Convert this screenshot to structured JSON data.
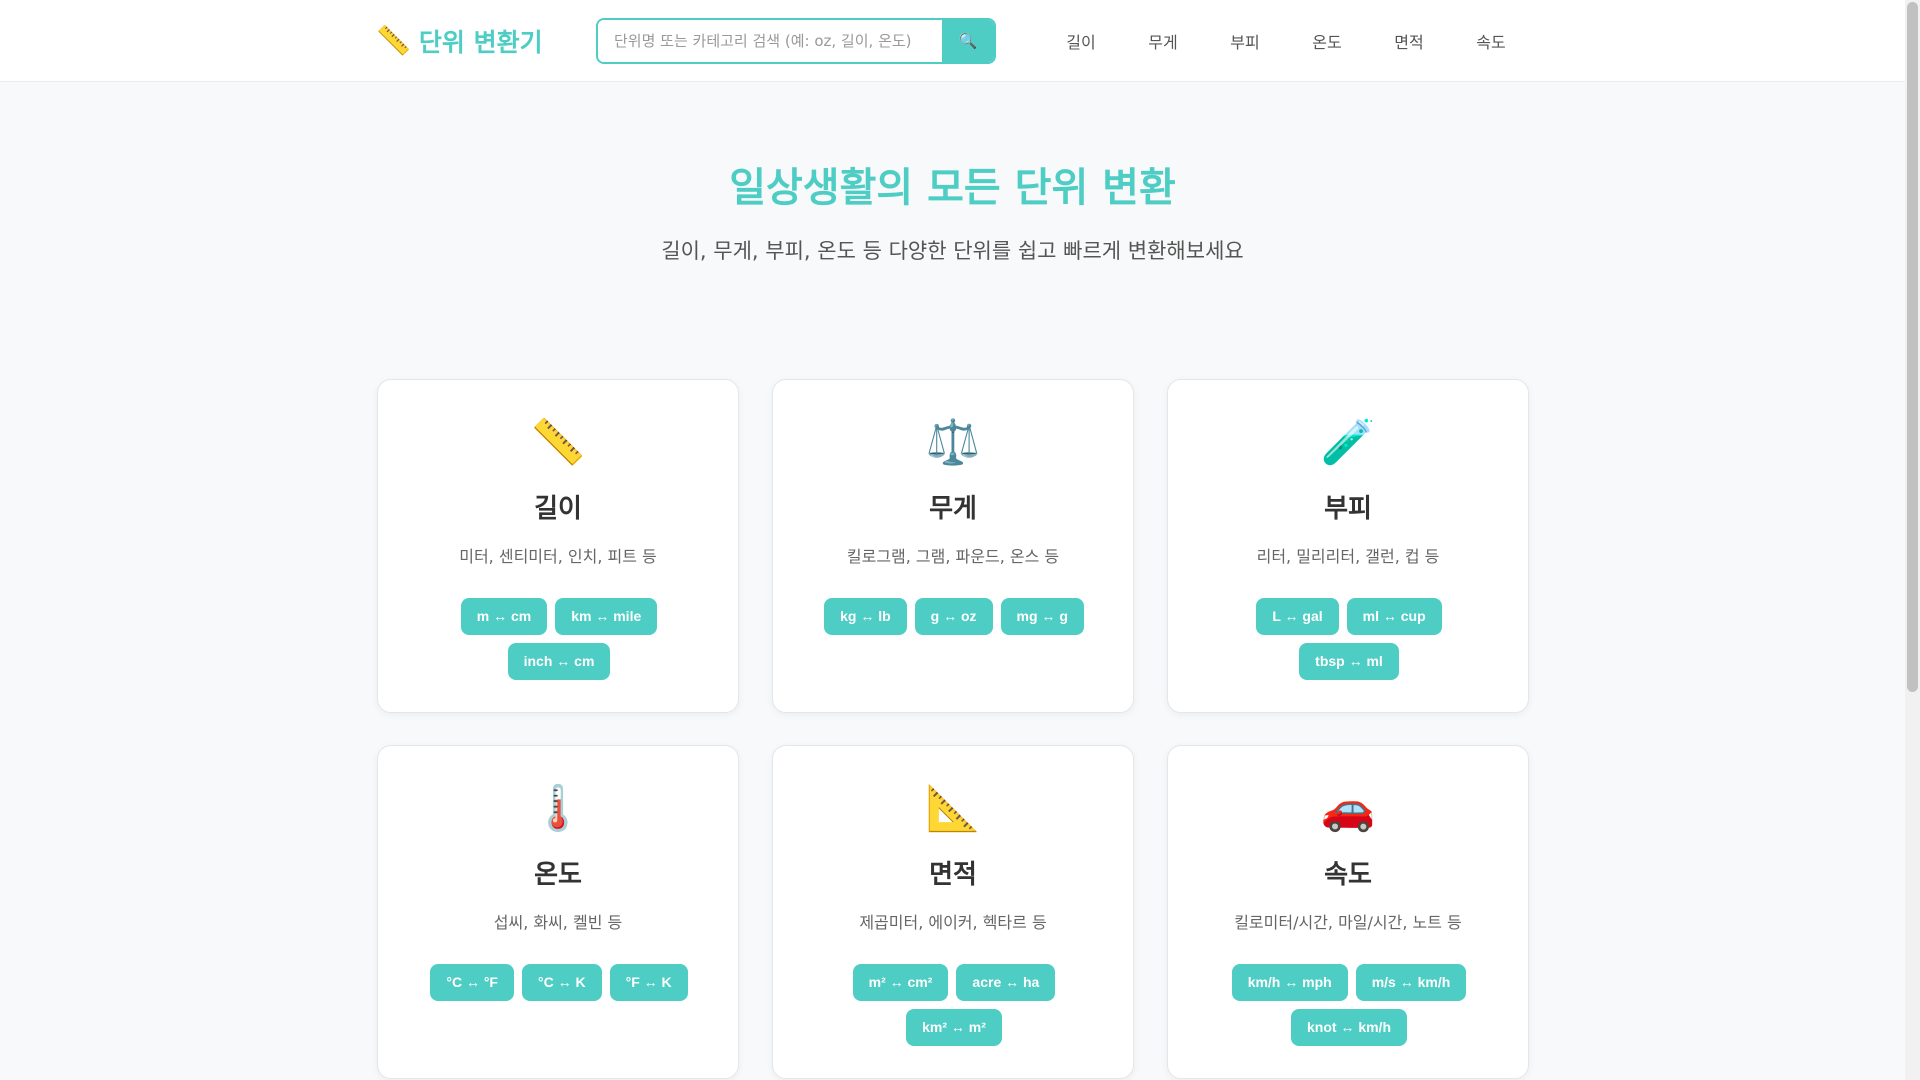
{
  "header": {
    "logo_icon": "📏",
    "logo_text": "단위 변환기",
    "search_placeholder": "단위명 또는 카테고리 검색 (예: oz, 길이, 온도)",
    "search_icon": "🔍",
    "nav": [
      "길이",
      "무게",
      "부피",
      "온도",
      "면적",
      "속도"
    ]
  },
  "hero": {
    "title": "일상생활의 모든 단위 변환",
    "subtitle": "길이, 무게, 부피, 온도 등 다양한 단위를 쉽고 빠르게 변환해보세요"
  },
  "theme": {
    "accent": "#4ecdc4"
  },
  "categories": [
    {
      "icon": "📏",
      "icon_name": "ruler-icon",
      "title": "길이",
      "desc": "미터, 센티미터, 인치, 피트 등",
      "chips": [
        "m ↔ cm",
        "km ↔ mile",
        "inch ↔ cm"
      ]
    },
    {
      "icon": "⚖️",
      "icon_name": "scale-icon",
      "title": "무게",
      "desc": "킬로그램, 그램, 파운드, 온스 등",
      "chips": [
        "kg ↔ lb",
        "g ↔ oz",
        "mg ↔ g"
      ]
    },
    {
      "icon": "🧪",
      "icon_name": "test-tube-icon",
      "title": "부피",
      "desc": "리터, 밀리리터, 갤런, 컵 등",
      "chips": [
        "L ↔ gal",
        "ml ↔ cup",
        "tbsp ↔ ml"
      ]
    },
    {
      "icon": "🌡️",
      "icon_name": "thermometer-icon",
      "title": "온도",
      "desc": "섭씨, 화씨, 켈빈 등",
      "chips": [
        "°C ↔ °F",
        "°C ↔ K",
        "°F ↔ K"
      ]
    },
    {
      "icon": "📐",
      "icon_name": "triangle-ruler-icon",
      "title": "면적",
      "desc": "제곱미터, 에이커, 헥타르 등",
      "chips": [
        "m² ↔ cm²",
        "acre ↔ ha",
        "km² ↔ m²"
      ]
    },
    {
      "icon": "🚗",
      "icon_name": "car-icon",
      "title": "속도",
      "desc": "킬로미터/시간, 마일/시간, 노트 등",
      "chips": [
        "km/h ↔ mph",
        "m/s ↔ km/h",
        "knot ↔ km/h"
      ]
    }
  ]
}
